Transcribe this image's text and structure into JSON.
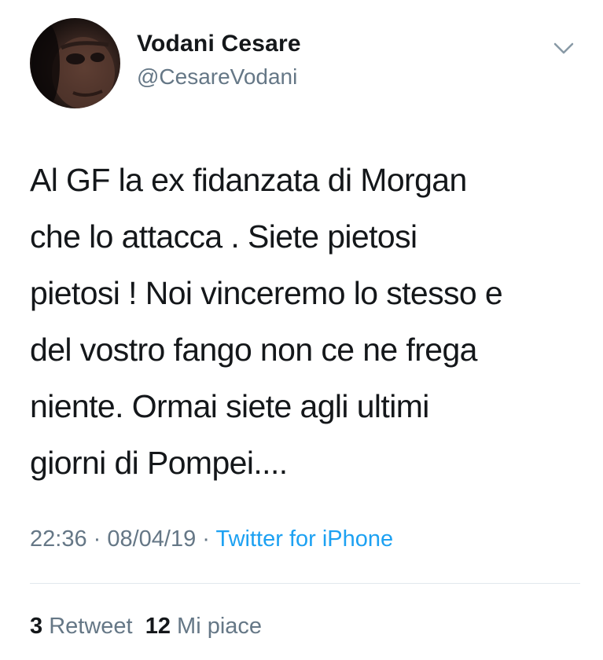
{
  "author": {
    "display_name": "Vodani Cesare",
    "handle": "@CesareVodani"
  },
  "tweet": {
    "text_lines": [
      "Al GF la ex fidanzata di Morgan",
      "che lo attacca . Siete pietosi",
      "pietosi ! Noi vinceremo lo stesso e",
      "del vostro fango non ce ne frega",
      "niente. Ormai siete agli ultimi",
      "giorni di Pompei...."
    ],
    "time": "22:36",
    "date": "08/04/19",
    "separator": " · ",
    "source": "Twitter for iPhone"
  },
  "stats": {
    "retweet_count": "3",
    "retweet_label": "Retweet",
    "like_count": "12",
    "like_label": "Mi piace"
  },
  "icons": {
    "menu": "chevron-down-icon"
  },
  "colors": {
    "text": "#14171a",
    "secondary": "#657786",
    "link": "#1da1f2",
    "divider": "#e1e8ed"
  }
}
